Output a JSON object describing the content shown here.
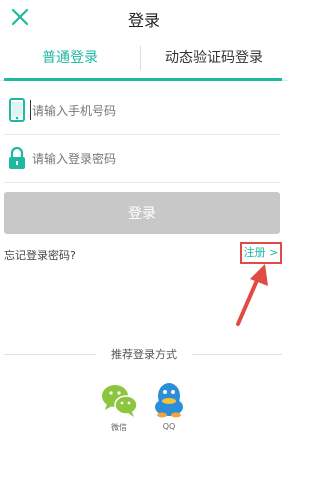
{
  "header": {
    "title": "登录",
    "close_icon": "close-icon"
  },
  "tabs": [
    {
      "label": "普通登录",
      "active": true
    },
    {
      "label": "动态验证码登录",
      "active": false
    }
  ],
  "form": {
    "phone_placeholder": "请输入手机号码",
    "password_placeholder": "请输入登录密码",
    "phone_icon": "phone-icon",
    "lock_icon": "lock-icon",
    "login_label": "登录"
  },
  "links": {
    "forgot": "忘记登录密码?",
    "register": "注册 >"
  },
  "social": {
    "heading": "推荐登录方式",
    "items": [
      {
        "label": "微信",
        "icon": "wechat-icon"
      },
      {
        "label": "QQ",
        "icon": "qq-icon"
      }
    ]
  },
  "colors": {
    "accent": "#1eb9a0",
    "login_button_disabled": "#c8c8c8",
    "annotation": "#e24b43"
  }
}
